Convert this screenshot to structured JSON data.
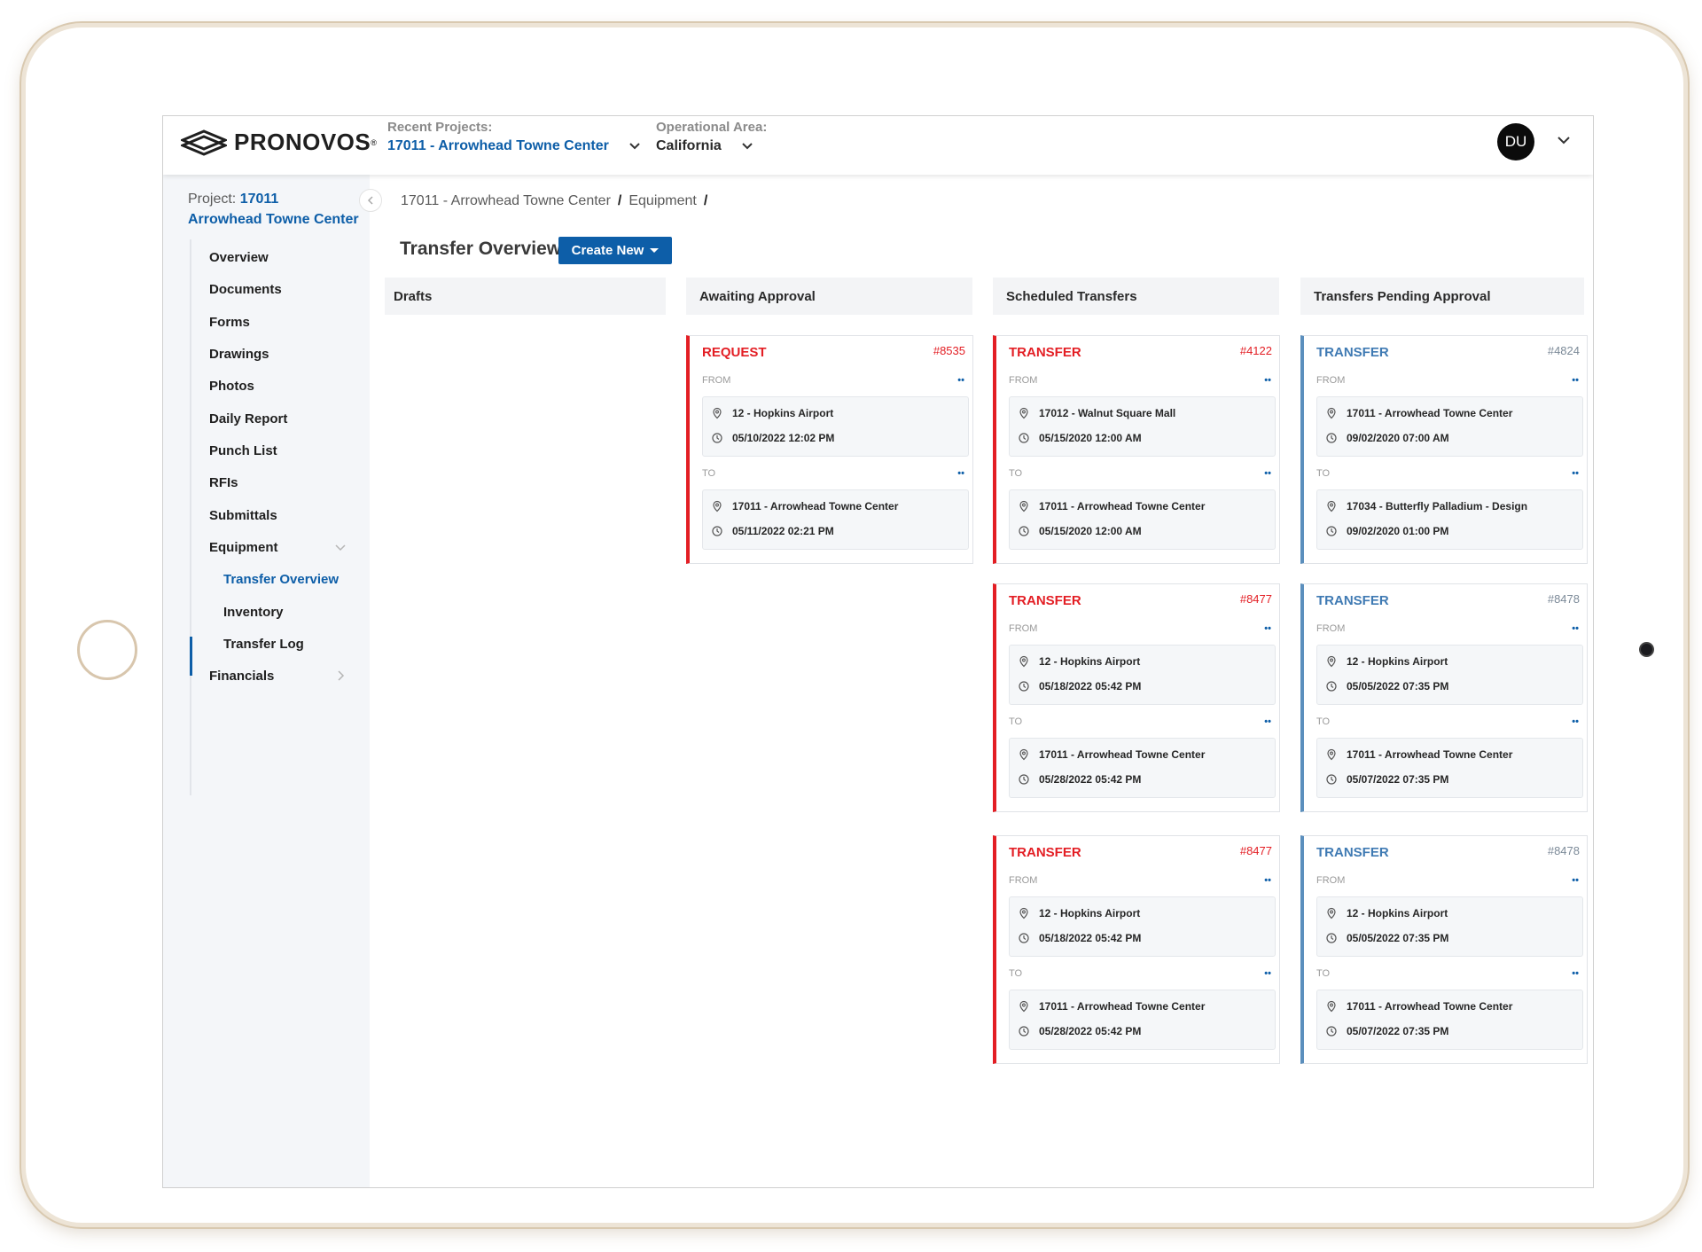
{
  "header": {
    "brand": "PRONOVOS",
    "recent_projects_label": "Recent Projects:",
    "recent_project": "17011 - Arrowhead Towne Center",
    "operational_area_label": "Operational Area:",
    "operational_area": "California",
    "avatar_initials": "DU"
  },
  "sidebar": {
    "project_label": "Project:",
    "project_number": "17011",
    "project_name": "Arrowhead Towne Center",
    "items": [
      {
        "label": "Overview"
      },
      {
        "label": "Documents"
      },
      {
        "label": "Forms"
      },
      {
        "label": "Drawings"
      },
      {
        "label": "Photos"
      },
      {
        "label": "Daily Report"
      },
      {
        "label": "Punch List"
      },
      {
        "label": "RFIs"
      },
      {
        "label": "Submittals"
      },
      {
        "label": "Equipment"
      },
      {
        "label": "Transfer Overview"
      },
      {
        "label": "Inventory"
      },
      {
        "label": "Transfer Log"
      },
      {
        "label": "Financials"
      }
    ]
  },
  "breadcrumb": {
    "project": "17011 - Arrowhead Towne Center",
    "section": "Equipment",
    "separator": "/"
  },
  "page": {
    "title": "Transfer Overview",
    "create_label": "Create New"
  },
  "columns": [
    {
      "title": "Drafts"
    },
    {
      "title": "Awaiting Approval"
    },
    {
      "title": "Scheduled Transfers"
    },
    {
      "title": "Transfers Pending Approval"
    }
  ],
  "labels": {
    "from": "FROM",
    "to": "TO",
    "link_icon": "••"
  },
  "colors": {
    "accent": "#0d5ea8",
    "red": "#e31e24",
    "blue": "#3f7ab3"
  },
  "cards": [
    {
      "type": "REQUEST",
      "number": "#8535",
      "from_location": "12 - Hopkins Airport",
      "from_date": "05/10/2022 12:02 PM",
      "to_location": "17011 - Arrowhead Towne Center",
      "to_date": "05/11/2022 02:21 PM"
    },
    {
      "type": "TRANSFER",
      "number": "#4122",
      "from_location": "17012 - Walnut Square Mall",
      "from_date": "05/15/2020 12:00 AM",
      "to_location": "17011 - Arrowhead Towne Center",
      "to_date": "05/15/2020 12:00 AM"
    },
    {
      "type": "TRANSFER",
      "number": "#4824",
      "from_location": "17011 - Arrowhead Towne Center",
      "from_date": "09/02/2020 07:00 AM",
      "to_location": "17034 - Butterfly Palladium - Design",
      "to_date": "09/02/2020 01:00 PM"
    },
    {
      "type": "TRANSFER",
      "number": "#8477",
      "from_location": "12 - Hopkins Airport",
      "from_date": "05/18/2022 05:42 PM",
      "to_location": "17011 - Arrowhead Towne Center",
      "to_date": "05/28/2022 05:42 PM"
    },
    {
      "type": "TRANSFER",
      "number": "#8478",
      "from_location": "12 - Hopkins Airport",
      "from_date": "05/05/2022 07:35 PM",
      "to_location": "17011 - Arrowhead Towne Center",
      "to_date": "05/07/2022 07:35 PM"
    },
    {
      "type": "TRANSFER",
      "number": "#8477",
      "from_location": "12 - Hopkins Airport",
      "from_date": "05/18/2022 05:42 PM",
      "to_location": "17011 - Arrowhead Towne Center",
      "to_date": "05/28/2022 05:42 PM"
    },
    {
      "type": "TRANSFER",
      "number": "#8478",
      "from_location": "12 - Hopkins Airport",
      "from_date": "05/05/2022 07:35 PM",
      "to_location": "17011 - Arrowhead Towne Center",
      "to_date": "05/07/2022 07:35 PM"
    }
  ]
}
